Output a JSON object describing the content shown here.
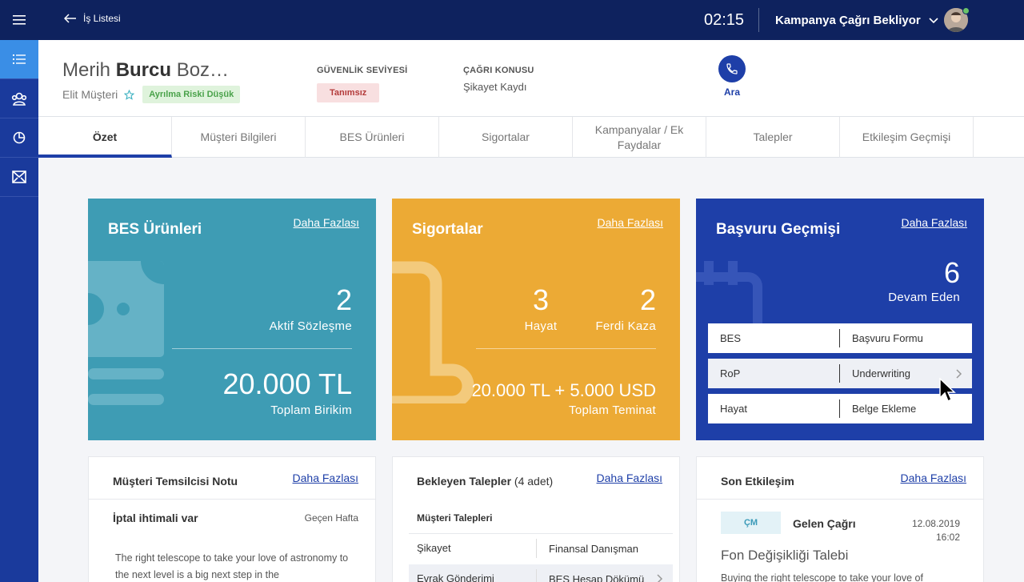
{
  "topbar": {
    "back_label": "İş Listesi",
    "timer": "02:15",
    "status": "Kampanya Çağrı Bekliyor"
  },
  "sidebar": {
    "items": [
      {
        "icon": "list-icon",
        "active": true
      },
      {
        "icon": "users-icon",
        "active": false
      },
      {
        "icon": "globe-icon",
        "active": false
      },
      {
        "icon": "mail-icon",
        "active": false
      }
    ]
  },
  "customer": {
    "first_name": "Merih",
    "middle_name": "Burcu",
    "last_name": "Boz…",
    "type": "Elit Müşteri",
    "risk_badge": "Ayrılma Riski Düşük"
  },
  "security": {
    "label": "GÜVENLİK SEVİYESİ",
    "value": "Tanımsız"
  },
  "topic": {
    "label": "ÇAĞRI KONUSU",
    "value": "Şikayet Kaydı"
  },
  "call": {
    "label": "Ara"
  },
  "tabs": [
    {
      "label": "Özet",
      "active": true
    },
    {
      "label": "Müşteri Bilgileri"
    },
    {
      "label": "BES Ürünleri"
    },
    {
      "label": "Sigortalar"
    },
    {
      "label": "Kampanyalar / Ek Faydalar"
    },
    {
      "label": "Talepler"
    },
    {
      "label": "Etkileşim Geçmişi"
    }
  ],
  "more_label": "Daha Fazlası",
  "bes_card": {
    "title": "BES Ürünleri",
    "count": "2",
    "count_label": "Aktif Sözleşme",
    "amount": "20.000 TL",
    "amount_label": "Toplam Birikim"
  },
  "sig_card": {
    "title": "Sigortalar",
    "left_count": "3",
    "left_label": "Hayat",
    "right_count": "2",
    "right_label": "Ferdi Kaza",
    "amount": "20.000 TL + 5.000 USD",
    "amount_label": "Toplam Teminat"
  },
  "bas_card": {
    "title": "Başvuru Geçmişi",
    "count": "6",
    "count_label": "Devam Eden",
    "rows": [
      {
        "type": "BES",
        "status": "Başvuru Formu"
      },
      {
        "type": "RoP",
        "status": "Underwriting"
      },
      {
        "type": "Hayat",
        "status": "Belge Ekleme"
      }
    ]
  },
  "note_card": {
    "title": "Müşteri Temsilcisi Notu",
    "note_title": "İptal ihtimali var",
    "note_date": "Geçen Hafta",
    "note_text": "The right telescope to take your love of astronomy to the next level is a big next step in the"
  },
  "req_card": {
    "title": "Bekleyen Talepler",
    "count_text": "(4 adet)",
    "section": "Müşteri Talepleri",
    "rows": [
      {
        "type": "Şikayet",
        "detail": "Finansal Danışman"
      },
      {
        "type": "Evrak Gönderimi",
        "detail": "BES Hesap Dökümü"
      }
    ]
  },
  "int_card": {
    "title": "Son Etkileşim",
    "badge": "ÇM",
    "kind": "Gelen Çağrı",
    "date": "12.08.2019",
    "time": "16:02",
    "subject": "Fon Değişikliği Talebi",
    "text": "Buying the right telescope to take your love of"
  }
}
